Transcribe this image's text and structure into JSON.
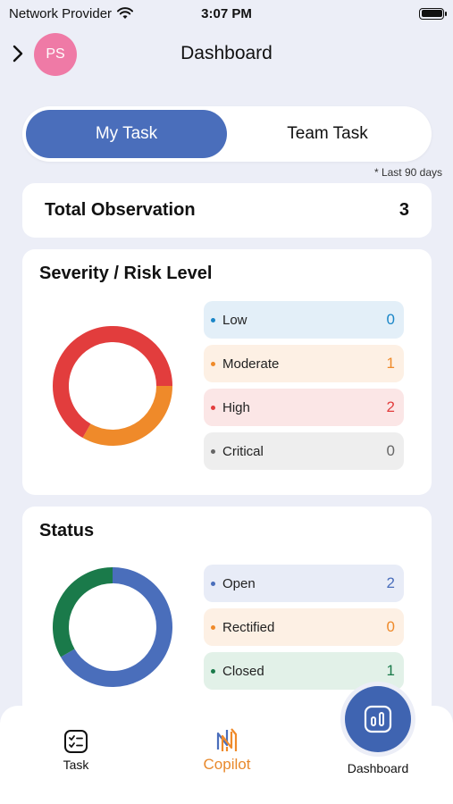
{
  "status_bar": {
    "carrier": "Network Provider",
    "time": "3:07 PM"
  },
  "header": {
    "avatar_initials": "PS",
    "title": "Dashboard"
  },
  "tabs": {
    "my_task": "My Task",
    "team_task": "Team Task",
    "active": "my_task"
  },
  "range_note": "* Last 90 days",
  "total": {
    "label": "Total Observation",
    "value": "3"
  },
  "severity": {
    "title": "Severity / Risk Level",
    "items": [
      {
        "label": "Low",
        "value": "0",
        "color": "#1a86c7",
        "bg": "#e3eff8"
      },
      {
        "label": "Moderate",
        "value": "1",
        "color": "#ef8a2a",
        "bg": "#fdf0e4"
      },
      {
        "label": "High",
        "value": "2",
        "color": "#e23d3d",
        "bg": "#fbe6e6"
      },
      {
        "label": "Critical",
        "value": "0",
        "color": "#666666",
        "bg": "#eeeeee"
      }
    ]
  },
  "status": {
    "title": "Status",
    "items": [
      {
        "label": "Open",
        "value": "2",
        "color": "#4a6ebb",
        "bg": "#e8ecf7"
      },
      {
        "label": "Rectified",
        "value": "0",
        "color": "#ef8a2a",
        "bg": "#fdf0e4"
      },
      {
        "label": "Closed",
        "value": "1",
        "color": "#1a7a4a",
        "bg": "#e2f1e8"
      }
    ]
  },
  "bottom_nav": {
    "task": "Task",
    "copilot": "Copilot",
    "dashboard": "Dashboard"
  },
  "icons": {
    "signal": "wifi-icon",
    "battery": "battery-icon",
    "back": "chevron-right-icon",
    "task": "task-checklist-icon",
    "copilot": "copilot-logo-icon",
    "dashboard": "bar-chart-icon"
  }
}
